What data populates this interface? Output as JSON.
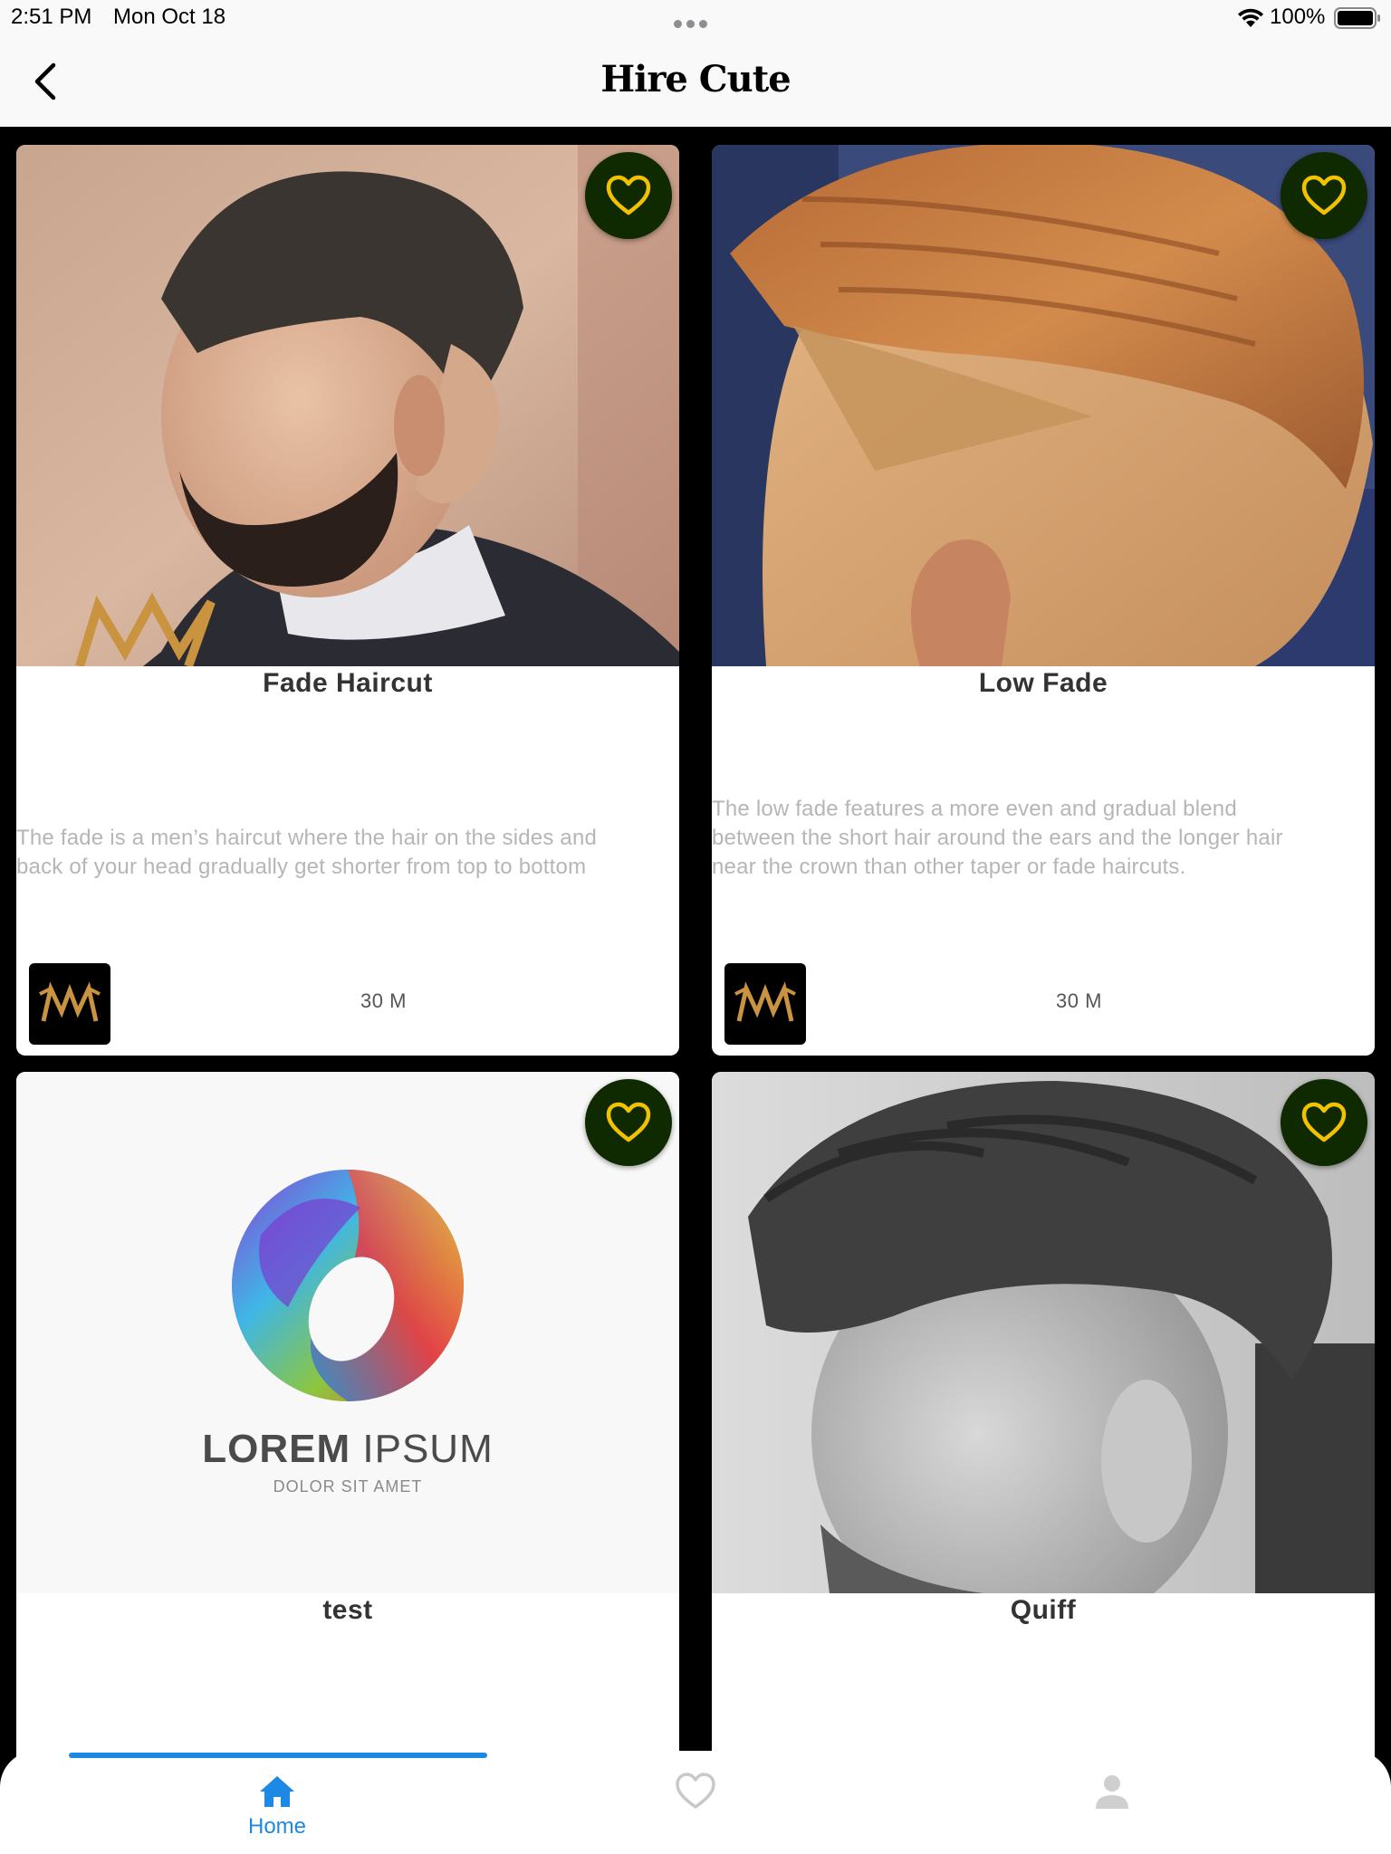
{
  "status_bar": {
    "time": "2:51 PM",
    "date": "Mon Oct 18",
    "battery": "100%"
  },
  "nav": {
    "title": "Hire Cute",
    "back_icon": "chevron-left-icon"
  },
  "colors": {
    "accent": "#1e88e5",
    "fav_bg": "#0f2a00",
    "fav_heart": "#f2c200",
    "logo_gold": "#c9933f"
  },
  "cards": [
    {
      "title": "Fade Haircut",
      "desc_line1": "The fade is a men’s haircut where the hair on the sides and",
      "desc_line2": "back of your head gradually get shorter from top to bottom",
      "desc_line3": "",
      "duration": "30 M",
      "favorite_icon": "heart-icon"
    },
    {
      "title": "Low Fade",
      "desc_line1": "The low fade features a more even and gradual blend",
      "desc_line2": "between the short hair around the ears and the longer hair",
      "desc_line3": "near the crown than other taper or fade haircuts.",
      "duration": "30 M",
      "favorite_icon": "heart-icon"
    },
    {
      "title": "test",
      "logo_text_bold": "LOREM",
      "logo_text_light": "IPSUM",
      "logo_tagline": "DOLOR SIT AMET",
      "favorite_icon": "heart-icon"
    },
    {
      "title": "Quiff",
      "favorite_icon": "heart-icon"
    }
  ],
  "tabs": [
    {
      "label": "Home",
      "icon": "home-icon",
      "active": true
    },
    {
      "label": "",
      "icon": "heart-icon",
      "active": false
    },
    {
      "label": "",
      "icon": "person-icon",
      "active": false
    }
  ]
}
